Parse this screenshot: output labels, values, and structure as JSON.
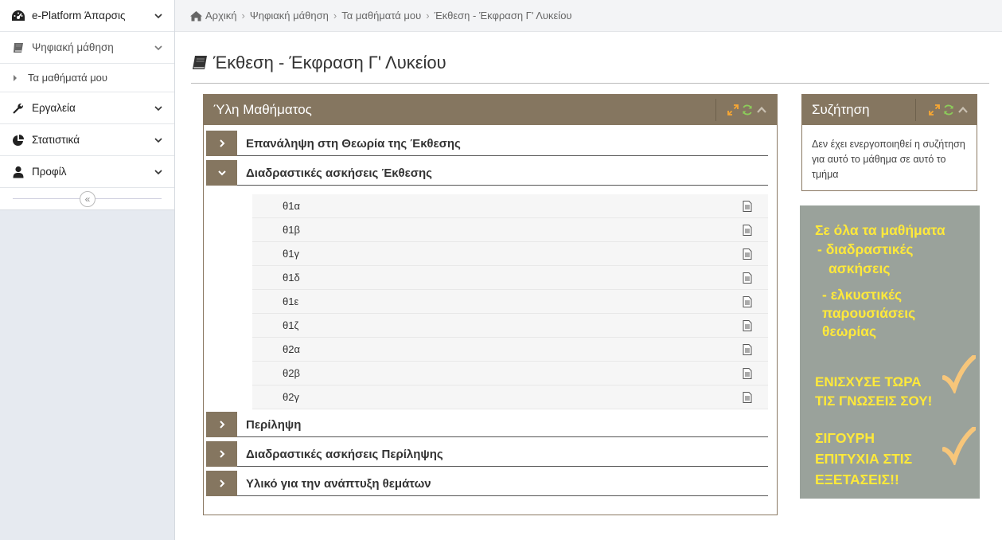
{
  "sidebar": {
    "items": [
      {
        "label": "e-Platform Άπαρσις",
        "icon": "dashboard-icon"
      },
      {
        "label": "Ψηφιακή μάθηση",
        "icon": "book-icon"
      },
      {
        "label": "Εργαλεία",
        "icon": "wrench-icon"
      },
      {
        "label": "Στατιστικά",
        "icon": "pie-chart-icon"
      },
      {
        "label": "Προφίλ",
        "icon": "user-icon"
      }
    ],
    "sub_item": "Τα μαθήματά μου",
    "collapse_symbol": "«"
  },
  "breadcrumb": [
    "Αρχική",
    "Ψηφιακή μάθηση",
    "Τα μαθήματά μου",
    "Έκθεση - Έκφραση Γ' Λυκείου"
  ],
  "page": {
    "title": "Έκθεση - Έκφραση Γ' Λυκείου"
  },
  "course_panel": {
    "title": "Ύλη Μαθήματος",
    "sections": [
      "Επανάληψη στη Θεωρία της Έκθεσης",
      "Διαδραστικές ασκήσεις Έκθεσης",
      "Περίληψη",
      "Διαδραστικές ασκήσεις Περίληψης",
      "Υλικό για την ανάπτυξη θεμάτων"
    ],
    "resources": [
      "θ1α",
      "θ1β",
      "θ1γ",
      "θ1δ",
      "θ1ε",
      "θ1ζ",
      "θ2α",
      "θ2β",
      "θ2γ"
    ]
  },
  "discussion": {
    "title": "Συζήτηση",
    "text": "Δεν έχει ενεργοποιηθεί η συζήτηση για αυτό το μάθημα σε αυτό το τμήμα"
  },
  "promo": {
    "line1": "Σε όλα τα μαθήματα",
    "line2": "- διαδραστικές",
    "line3": "ασκήσεις",
    "line4": "- ελκυστικές",
    "line5": "παρουσιάσεις",
    "line6": "θεωρίας",
    "line7": "ΕΝΙΣΧΥΣΕ ΤΩΡΑ",
    "line8": "ΤΙΣ ΓΝΩΣΕΙΣ ΣΟΥ!",
    "line9": "ΣΙΓΟΥΡΗ",
    "line10": "ΕΠΙΤΥΧΙΑ ΣΤΙΣ",
    "line11": "ΕΞΕΤΑΣΕΙΣ!!"
  },
  "colors": {
    "accent": "#857660",
    "promo_bg": "#9aa29b",
    "promo_text": "#ffe93a",
    "check": "#f7c67a"
  }
}
